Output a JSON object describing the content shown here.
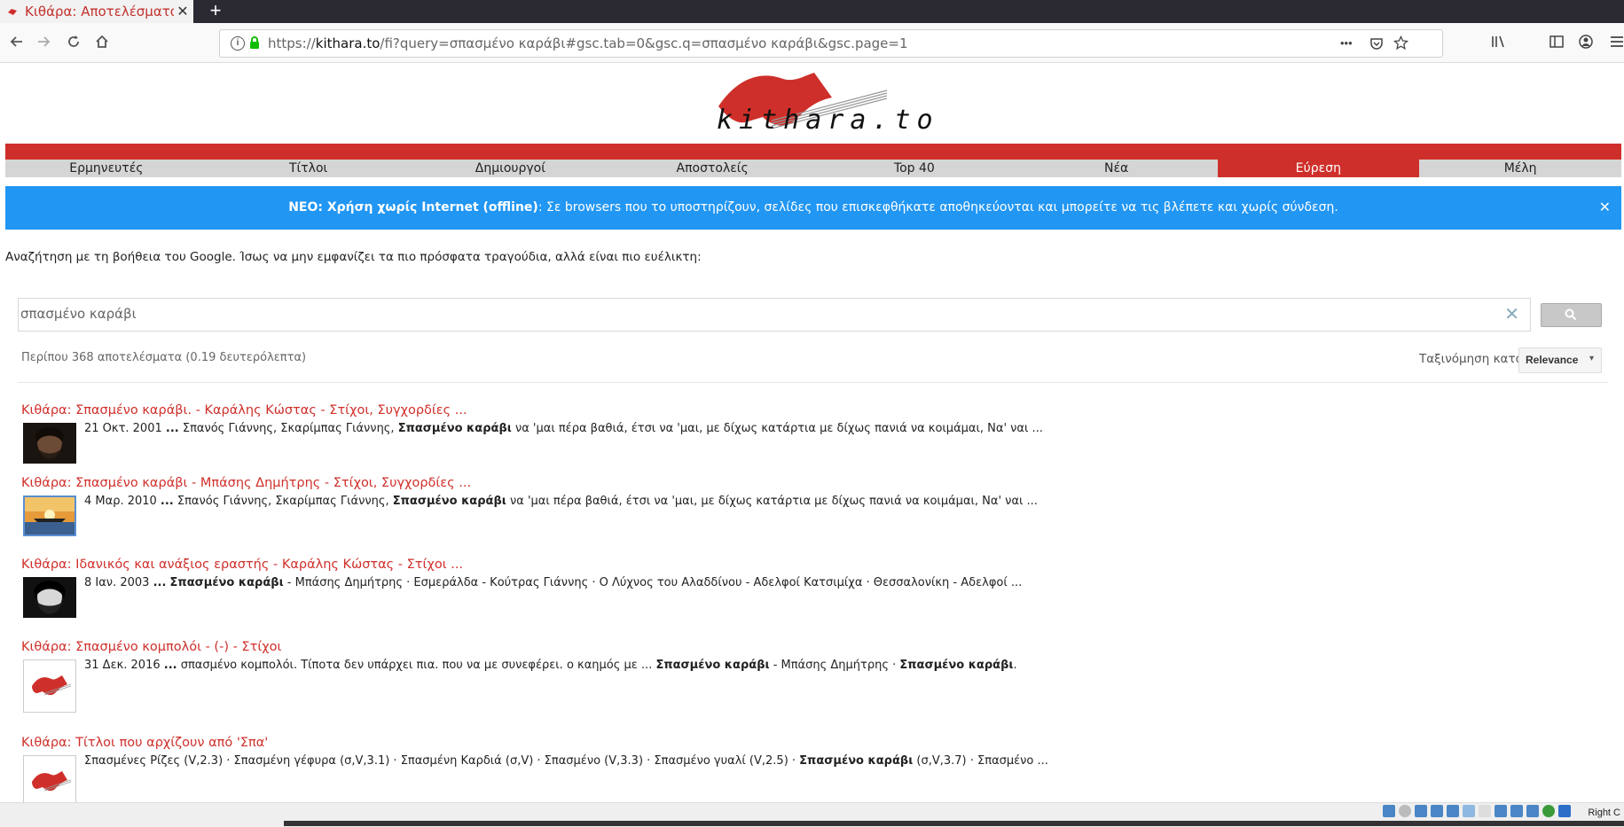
{
  "browser": {
    "tab_title": "Κιθάρα: Αποτελέσματα α",
    "tab_close": "✕",
    "new_tab": "+",
    "url_scheme": "https://",
    "url_domain": "kithara.to",
    "url_path": "/fi?query=σπασμένο καράβι#gsc.tab=0&gsc.q=σπασμένο καράβι&gsc.page=1",
    "info_icon": "i",
    "more_icon": "•••"
  },
  "site": {
    "logo_text": "kithara.to",
    "menu": [
      {
        "label": "Ερμηνευτές",
        "active": false
      },
      {
        "label": "Τίτλοι",
        "active": false
      },
      {
        "label": "Δημιουργοί",
        "active": false
      },
      {
        "label": "Αποστολείς",
        "active": false
      },
      {
        "label": "Top 40",
        "active": false
      },
      {
        "label": "Νέα",
        "active": false
      },
      {
        "label": "Εύρεση",
        "active": true
      },
      {
        "label": "Μέλη",
        "active": false
      }
    ],
    "banner_bold": "ΝΕΟ: Χρήση χωρίς Internet (offline)",
    "banner_text": ": Σε browsers που το υποστηρίζουν, σελίδες που επισκεφθήκατε αποθηκεύονται και μπορείτε να τις βλέπετε και χωρίς σύνδεση.",
    "banner_close": "✕",
    "intro": "Αναζήτηση με τη βοήθεια του Google. Ίσως να μην εμφανίζει τα πιο πρόσφατα τραγούδια, αλλά είναι πιο ευέλικτη:"
  },
  "search": {
    "value": "σπασμένο καράβι",
    "clear": "✕",
    "result_count": "Περίπου 368 αποτελέσματα (0.19 δευτερόλεπτα)",
    "sort_label": "Ταξινόμηση κατά:",
    "sort_value": "Relevance",
    "sort_caret": "▾"
  },
  "results": [
    {
      "title": "Κιθάρα: Σπασμένο καράβι. - Καράλης Κώστας - Στίχοι, Συγχορδίες ...",
      "snippet_pre": "21 Οκτ. 2001 ",
      "snippet_ellipsis": "...",
      "snippet_mid": " Σπανός Γιάννης, Σκαρίμπας Γιάννης, ",
      "snippet_bold": "Σπασμένο καράβι",
      "snippet_post": " να 'μαι πέρα βαθιά, έτσι να 'μαι, με δίχως κατάρτια με δίχως πανιά να κοιμάμαι, Να' ναι ...",
      "thumb": "portrait-dark"
    },
    {
      "title": "Κιθάρα: Σπασμένο καράβι - Μπάσης Δημήτρης - Στίχοι, Συγχορδίες ...",
      "snippet_pre": "4 Μαρ. 2010 ",
      "snippet_ellipsis": "...",
      "snippet_mid": " Σπανός Γιάννης, Σκαρίμπας Γιάννης, ",
      "snippet_bold": "Σπασμένο καράβι",
      "snippet_post": " να 'μαι πέρα βαθιά, έτσι να 'μαι, με δίχως κατάρτια με δίχως πανιά να κοιμάμαι, Να' ναι ...",
      "thumb": "sunset-ship"
    },
    {
      "title": "Κιθάρα: Ιδανικός και ανάξιος εραστής - Καράλης Κώστας - Στίχοι ...",
      "snippet_pre": "8 Ιαν. 2003 ",
      "snippet_ellipsis": "...",
      "snippet_mid": " ",
      "snippet_bold": "Σπασμένο καράβι",
      "snippet_post": " - Μπάσης Δημήτρης · Εσμεράλδα - Κούτρας Γιάννης · Ο Λύχνος του Αλαδδίνου - Αδελφοί Κατσιμίχα · Θεσσαλονίκη - Αδελφοί ...",
      "thumb": "portrait-bw"
    },
    {
      "title": "Κιθάρα: Σπασμένο κομπολόι - (-) - Στίχοι",
      "snippet_pre": "31 Δεκ. 2016 ",
      "snippet_ellipsis": "...",
      "snippet_mid": " σπασμένο κομπολόι. Τίποτα δεν υπάρχει πια. που να με συνεφέρει. ο καημός με ... ",
      "snippet_bold": "Σπασμένο καράβι",
      "snippet_post": " - Μπάσης Δημήτρης · ",
      "snippet_bold2": "Σπασμένο καράβι",
      "snippet_tail": ".",
      "thumb": "logo"
    },
    {
      "title": "Κιθάρα: Τίτλοι που αρχίζουν από 'Σπα'",
      "snippet_pre": "",
      "snippet_ellipsis": "",
      "snippet_mid": "Σπασμένες Ρίζες (V,2.3) · Σπασμένη γέφυρα (σ,V,3.1) · Σπασμένη Καρδιά (σ,V) · Σπασμένο (V,3.3) · Σπασμένο γυαλί (V,2.5) · ",
      "snippet_bold": "Σπασμένο καράβι",
      "snippet_post": " (σ,V,3.7) · Σπασμένο ...",
      "thumb": "logo"
    }
  ],
  "statusbar": {
    "right_text": "Right C"
  },
  "colors": {
    "brand_red": "#cf2f2a",
    "banner_blue": "#2196f3"
  }
}
